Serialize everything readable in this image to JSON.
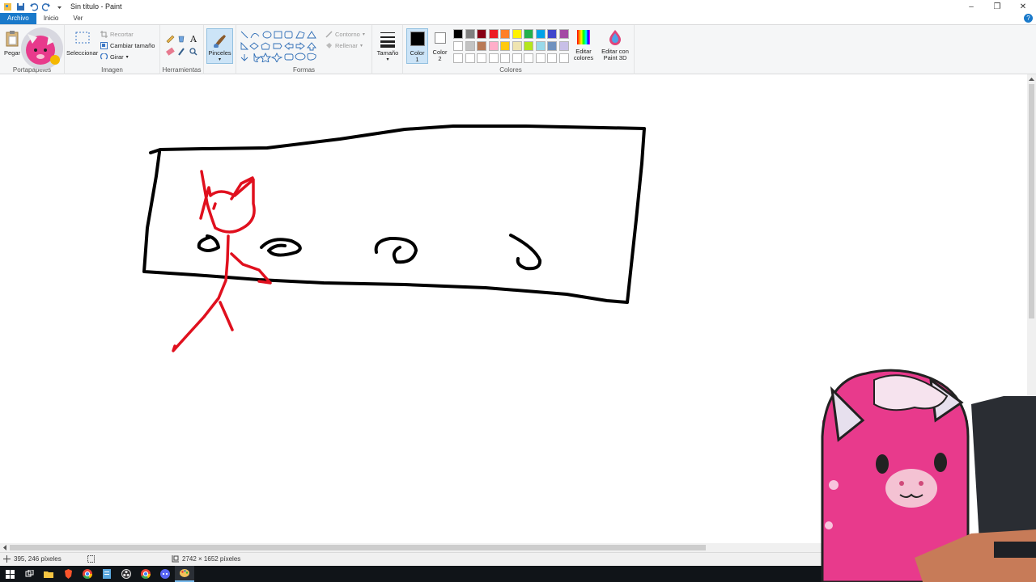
{
  "window": {
    "title": "Sin título - Paint",
    "minimize": "–",
    "restore": "❐",
    "close": "✕"
  },
  "tabs": [
    {
      "label": "Archivo"
    },
    {
      "label": "Inicio"
    },
    {
      "label": "Ver"
    }
  ],
  "help_label": "?",
  "ribbon": {
    "clipboard": {
      "paste_label": "Pegar",
      "group_label": "Portapapeles"
    },
    "image": {
      "select_label": "Seleccionar",
      "crop_label": "Recortar",
      "resize_label": "Cambiar tamaño",
      "rotate_label": "Girar",
      "group_label": "Imagen"
    },
    "tools": {
      "group_label": "Herramientas"
    },
    "brushes": {
      "label": "Pinceles"
    },
    "shapes": {
      "outline_label": "Contorno",
      "fill_label": "Rellenar",
      "group_label": "Formas"
    },
    "size_label": "Tamaño",
    "color1": {
      "label": "Color",
      "num": "1",
      "value": "#000000"
    },
    "color2": {
      "label": "Color",
      "num": "2",
      "value": "#ffffff"
    },
    "colors": {
      "group_label": "Colores",
      "row1": [
        "#000000",
        "#7f7f7f",
        "#880015",
        "#ed1c24",
        "#ff7f27",
        "#fff200",
        "#22b14c",
        "#00a2e8",
        "#3f48cc",
        "#a349a4"
      ],
      "row2": [
        "#ffffff",
        "#c3c3c3",
        "#b97a57",
        "#ffaec9",
        "#ffc90e",
        "#efe4b0",
        "#b5e61d",
        "#99d9ea",
        "#7092be",
        "#c8bfe7"
      ],
      "row3": [
        "#ffffff",
        "#ffffff",
        "#ffffff",
        "#ffffff",
        "#ffffff",
        "#ffffff",
        "#ffffff",
        "#ffffff",
        "#ffffff",
        "#ffffff"
      ]
    },
    "edit_colors": {
      "line1": "Editar",
      "line2": "colores"
    },
    "paint3d": {
      "line1": "Editar con",
      "line2": "Paint 3D"
    }
  },
  "status": {
    "cursor_pos": "395, 246 píxeles",
    "image_size": "2742 × 1652 píxeles"
  },
  "drawing": {
    "black_stroke": "#000000",
    "red_stroke": "#e0101e"
  },
  "overlay": {
    "mascot_color": "#e83a8c",
    "monitor_color": "#2a2d33",
    "desk_color": "#c77b58"
  }
}
